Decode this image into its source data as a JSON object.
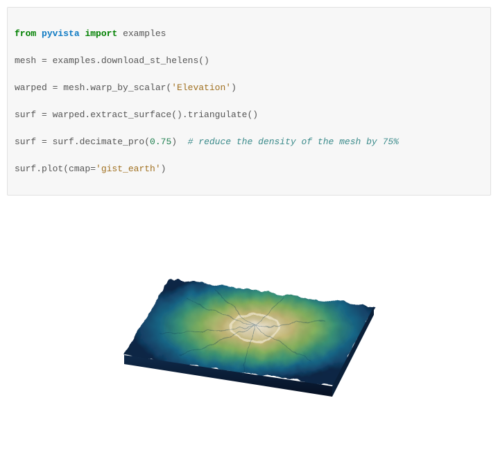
{
  "code": {
    "line1_kw_from": "from",
    "line1_mod": "pyvista",
    "line1_kw_import": "import",
    "line1_name": "examples",
    "line2": "mesh = examples.download_st_helens()",
    "line3_a": "warped = mesh.warp_by_scalar(",
    "line3_str": "'Elevation'",
    "line3_b": ")",
    "line4": "surf = warped.extract_surface().triangulate()",
    "line5_a": "surf = surf.decimate_pro(",
    "line5_num": "0.75",
    "line5_b": ")  ",
    "line5_cmt": "# reduce the density of the mesh by 75%",
    "line6_a": "surf.plot(cmap=",
    "line6_str": "'gist_earth'",
    "line6_b": ")"
  },
  "chart_data": {
    "type": "heatmap",
    "title": "",
    "description": "3D rendered terrain surface of Mt. St. Helens elevation data, colored with gist_earth colormap (dark blue low elevation through green/tan to pale peak), shown as an isometric slab",
    "colormap": "gist_earth",
    "scalar": "Elevation",
    "decimate": 0.75,
    "legend": false
  }
}
